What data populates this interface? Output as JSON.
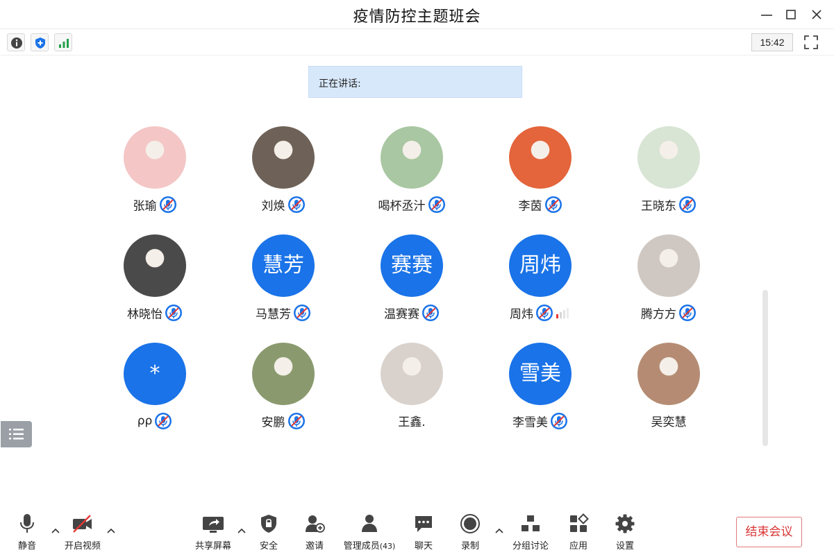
{
  "window": {
    "title": "疫情防控主题班会"
  },
  "infobar": {
    "clock": "15:42",
    "icons": [
      "info-icon",
      "shield-icon",
      "signal-icon"
    ]
  },
  "speaking": {
    "label": "正在讲话:"
  },
  "participants": [
    {
      "name": "张瑜",
      "avatar_type": "photo",
      "avatar_text": "",
      "avatar_color": "#f4c6c6",
      "mic": "muted"
    },
    {
      "name": "刘焕",
      "avatar_type": "photo",
      "avatar_text": "",
      "avatar_color": "#6e6258",
      "mic": "muted"
    },
    {
      "name": "喝杯丞汁",
      "avatar_type": "photo",
      "avatar_text": "",
      "avatar_color": "#a9c7a2",
      "mic": "muted"
    },
    {
      "name": "李茵",
      "avatar_type": "photo",
      "avatar_text": "",
      "avatar_color": "#e4643b",
      "mic": "muted"
    },
    {
      "name": "王晓东",
      "avatar_type": "photo",
      "avatar_text": "",
      "avatar_color": "#d8e4d4",
      "mic": "muted"
    },
    {
      "name": "林晓怡",
      "avatar_type": "photo",
      "avatar_text": "",
      "avatar_color": "#4a4a4a",
      "mic": "muted"
    },
    {
      "name": "马慧芳",
      "avatar_type": "text",
      "avatar_text": "慧芳",
      "avatar_color": "#1a73e8",
      "mic": "muted"
    },
    {
      "name": "温赛赛",
      "avatar_type": "text",
      "avatar_text": "赛赛",
      "avatar_color": "#1a73e8",
      "mic": "muted"
    },
    {
      "name": "周炜",
      "avatar_type": "text",
      "avatar_text": "周炜",
      "avatar_color": "#1a73e8",
      "mic": "muted",
      "volume": true
    },
    {
      "name": "腾方方",
      "avatar_type": "photo",
      "avatar_text": "",
      "avatar_color": "#cfc8c2",
      "mic": "muted"
    },
    {
      "name": "ρρ",
      "avatar_type": "text",
      "avatar_text": "*",
      "avatar_color": "#1a73e8",
      "mic": "muted"
    },
    {
      "name": "安鹏",
      "avatar_type": "photo",
      "avatar_text": "",
      "avatar_color": "#8a9a6e",
      "mic": "muted"
    },
    {
      "name": "王鑫.",
      "avatar_type": "photo",
      "avatar_text": "",
      "avatar_color": "#d9d2cc",
      "mic": "none"
    },
    {
      "name": "李雪美",
      "avatar_type": "text",
      "avatar_text": "雪美",
      "avatar_color": "#1a73e8",
      "mic": "muted"
    },
    {
      "name": "吴奕慧",
      "avatar_type": "photo",
      "avatar_text": "",
      "avatar_color": "#b58c73",
      "mic": "none"
    }
  ],
  "toolbar": {
    "mute_label": "静音",
    "video_label": "开启视频",
    "share_label": "共享屏幕",
    "security_label": "安全",
    "invite_label": "邀请",
    "members_label": "管理成员",
    "members_count": "(43)",
    "chat_label": "聊天",
    "record_label": "录制",
    "breakout_label": "分组讨论",
    "apps_label": "应用",
    "settings_label": "设置",
    "end_label": "结束会议"
  },
  "colors": {
    "accent": "#1a73e8",
    "end_button": "#d93434",
    "speaking_bg": "#d7e8fb"
  }
}
